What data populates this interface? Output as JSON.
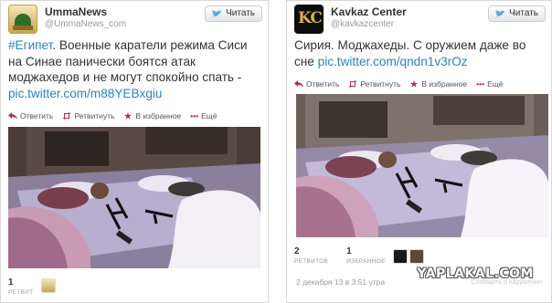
{
  "left": {
    "name": "UmmaNews",
    "handle": "@UmmaNews_com",
    "follow_label": "Читать",
    "text_hashtag": "#Египет",
    "text_body": ". Военные каратели режима Сиси на Синае панически боятся атак моджахедов и не могут спокойно спать - ",
    "text_link": "pic.twitter.com/m88YEBxgiu",
    "actions": {
      "reply": "Ответить",
      "retweet": "Ретвитнуть",
      "favorite": "В избранное",
      "more": "Ещё"
    },
    "retweet_count": "1",
    "retweet_label": "РЕТВИТ"
  },
  "right": {
    "name": "Kavkaz Center",
    "handle": "@kavkazcenter",
    "follow_label": "Читать",
    "text_body": "Сирия. Моджахеды. С оружием даже во сне ",
    "text_link": "pic.twitter.com/qndn1v3rOz",
    "actions": {
      "reply": "Ответить",
      "retweet": "Ретвитнуть",
      "favorite": "В избранное",
      "more": "Ещё"
    },
    "retweet_count": "2",
    "retweet_label": "РЕТВИТОВ",
    "favorite_count": "1",
    "favorite_label": "ИЗБРАННОЕ",
    "date": "2 декабря 13 в 3:51 утра",
    "faded_text": "Сообщить о нарушении"
  },
  "watermark": "YAPLAKAL.COM",
  "colors": {
    "link": "#2a84c6",
    "text": "#333333",
    "muted": "#999999"
  },
  "icons": [
    "bird-icon",
    "reply-icon",
    "retweet-icon",
    "star-icon",
    "more-icon"
  ]
}
